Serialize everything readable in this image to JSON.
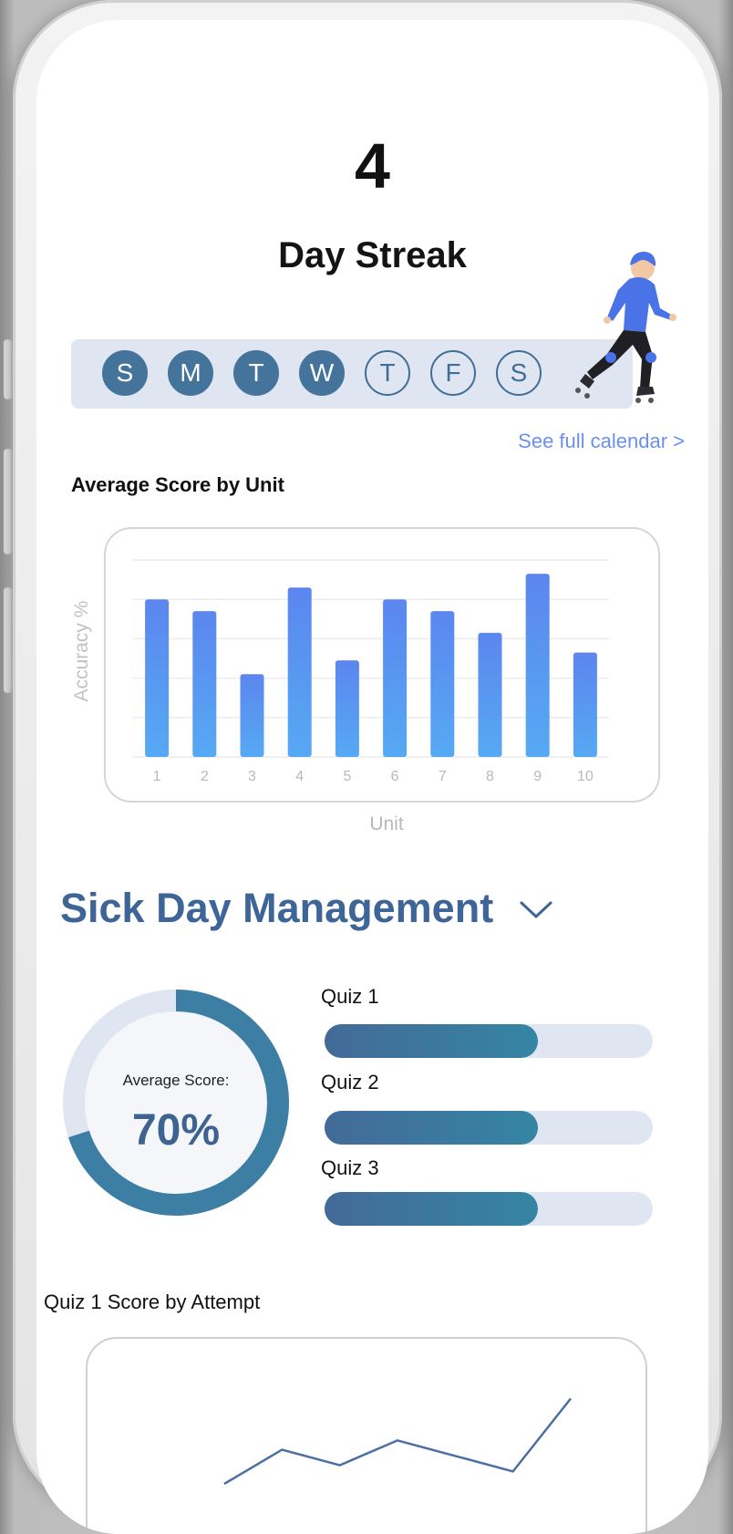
{
  "streak": {
    "count": "4",
    "label": "Day Streak"
  },
  "week": [
    {
      "letter": "S",
      "completed": true
    },
    {
      "letter": "M",
      "completed": true
    },
    {
      "letter": "T",
      "completed": true
    },
    {
      "letter": "W",
      "completed": true
    },
    {
      "letter": "T",
      "completed": false
    },
    {
      "letter": "F",
      "completed": false
    },
    {
      "letter": "S",
      "completed": false
    }
  ],
  "calendar_link": "See full calendar >",
  "unit_chart_title": "Average Score by Unit",
  "chart_data": [
    {
      "type": "bar",
      "title": "Average Score by Unit",
      "xlabel": "Unit",
      "ylabel": "Accuracy %",
      "categories": [
        "1",
        "2",
        "3",
        "4",
        "5",
        "6",
        "7",
        "8",
        "9",
        "10"
      ],
      "values": [
        80,
        74,
        42,
        86,
        49,
        80,
        74,
        63,
        93,
        53
      ],
      "ylim": [
        0,
        100
      ],
      "grid": true,
      "colors": {
        "bar_top": "#5b86ee",
        "bar_bottom": "#56a9f4"
      }
    },
    {
      "type": "line",
      "title": "Quiz 1 Score by Attempt",
      "x": [
        1,
        2,
        3,
        4,
        5,
        6,
        7
      ],
      "values": [
        30,
        52,
        42,
        58,
        48,
        38,
        85
      ],
      "ylim": [
        0,
        100
      ],
      "colors": {
        "line": "#4a6fa3"
      }
    }
  ],
  "module": {
    "title": "Sick Day Management",
    "average_caption": "Average Score:",
    "average_value": "70%",
    "average_fraction": 0.7,
    "quizzes": [
      {
        "label": "Quiz 1",
        "fraction": 0.65
      },
      {
        "label": "Quiz 2",
        "fraction": 0.65
      },
      {
        "label": "Quiz 3",
        "fraction": 0.65
      }
    ]
  },
  "attempt_chart_title": "Quiz 1 Score by Attempt",
  "icons": {
    "dropdown": "chevron-down-icon",
    "mascot": "roller-skater-illustration"
  },
  "colors": {
    "accent": "#3d6597",
    "link": "#6b8ff2",
    "track": "#dfe6f2",
    "week_bg": "#dfe6f1"
  }
}
